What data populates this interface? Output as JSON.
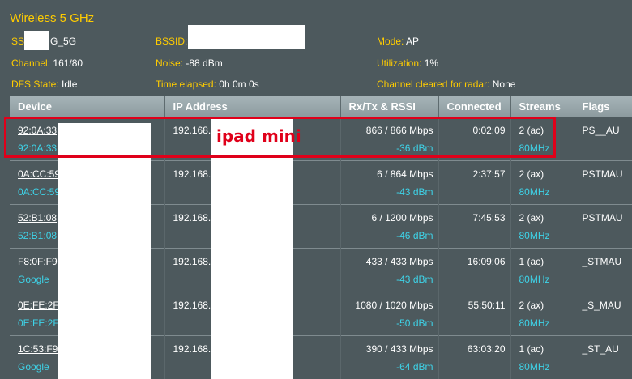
{
  "header": {
    "title": "Wireless 5 GHz",
    "ssid_label": "SS",
    "ssid_value": "G_5G",
    "bssid_label": "BSSID:",
    "mode_label": "Mode:",
    "mode_value": "AP",
    "channel_label": "Channel:",
    "channel_value": "161/80",
    "noise_label": "Noise:",
    "noise_value": "-88 dBm",
    "utilization_label": "Utilization:",
    "utilization_value": "1%",
    "dfs_label": "DFS State:",
    "dfs_value": "Idle",
    "elapsed_label": "Time elapsed:",
    "elapsed_value": "0h 0m 0s",
    "radar_label": "Channel cleared for radar:",
    "radar_value": "None"
  },
  "table": {
    "headers": [
      "Device",
      "IP Address",
      "Rx/Tx & RSSI",
      "Connected",
      "Streams",
      "Flags"
    ],
    "rows": [
      {
        "mac": "92:0A:33",
        "name": "92:0A:33",
        "ip": "192.168.",
        "rate": "866 / 866 Mbps",
        "rssi": "-36 dBm",
        "connected": "0:02:09",
        "streams": "2 (ac)",
        "bw": "80MHz",
        "flags": "PS__AU"
      },
      {
        "mac": "0A:CC:59",
        "name": "0A:CC:59",
        "ip": "192.168.",
        "rate": "6 / 864 Mbps",
        "rssi": "-43 dBm",
        "connected": "2:37:57",
        "streams": "2 (ax)",
        "bw": "80MHz",
        "flags": "PSTMAU"
      },
      {
        "mac": "52:B1:08",
        "name": "52:B1:08",
        "ip": "192.168.",
        "rate": "6 / 1200 Mbps",
        "rssi": "-46 dBm",
        "connected": "7:45:53",
        "streams": "2 (ax)",
        "bw": "80MHz",
        "flags": "PSTMAU"
      },
      {
        "mac": "F8:0F:F9",
        "name": "Google",
        "ip": "192.168.",
        "rate": "433 / 433 Mbps",
        "rssi": "-43 dBm",
        "connected": "16:09:06",
        "streams": "1 (ac)",
        "bw": "80MHz",
        "flags": "_STMAU"
      },
      {
        "mac": "0E:FE:2F",
        "name": "0E:FE:2F",
        "ip": "192.168.",
        "rate": "1080 / 1020 Mbps",
        "rssi": "-50 dBm",
        "connected": "55:50:11",
        "streams": "2 (ax)",
        "bw": "80MHz",
        "flags": "_S_MAU"
      },
      {
        "mac": "1C:53:F9",
        "name": "Google",
        "ip": "192.168.",
        "rate": "390 / 433 Mbps",
        "rssi": "-64 dBm",
        "connected": "63:03:20",
        "streams": "1 (ac)",
        "bw": "80MHz",
        "flags": "_ST_AU"
      }
    ]
  },
  "annotation": {
    "text": "ipad mini",
    "color": "#e0001a"
  },
  "colors": {
    "background": "#4d595d",
    "label": "#ffcc00",
    "accent": "#3ed3e8"
  }
}
